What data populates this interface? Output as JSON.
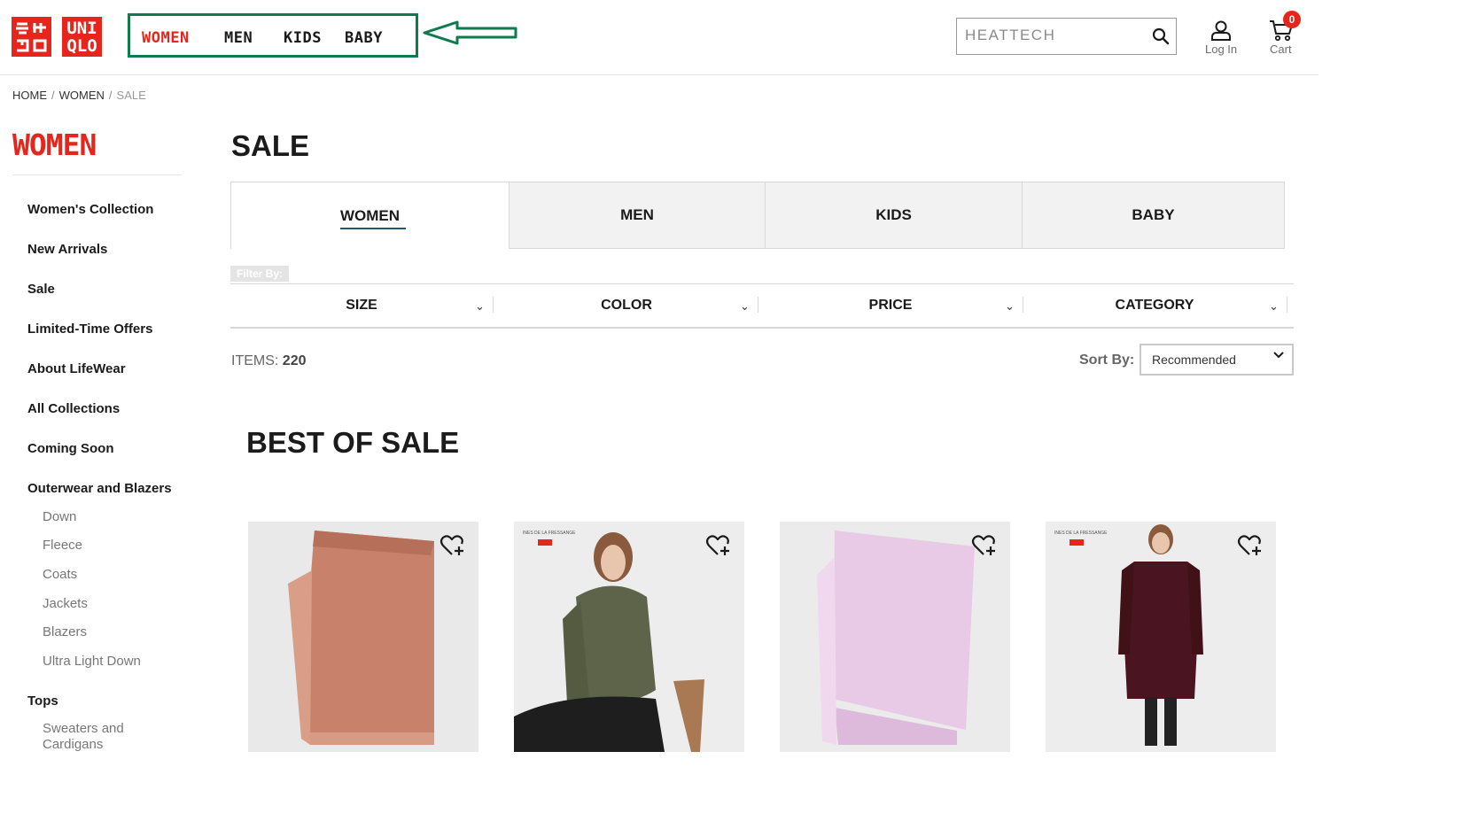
{
  "header": {
    "logo": {
      "top": "UNI",
      "bottom": "QLO"
    },
    "nav": [
      "WOMEN",
      "MEN",
      "KIDS",
      "BABY"
    ],
    "active_nav": "WOMEN",
    "search": {
      "placeholder": "HEATTECH",
      "value": ""
    },
    "login_label": "Log In",
    "cart_label": "Cart",
    "cart_count": "0",
    "colors": {
      "brand": "#e6261d",
      "highlight_box": "#0f7a4e"
    }
  },
  "breadcrumb": {
    "home": "HOME",
    "women": "WOMEN",
    "current": "SALE"
  },
  "sidebar": {
    "title": "WOMEN",
    "items": [
      "Women's Collection",
      "New Arrivals",
      "Sale",
      "Limited-Time Offers",
      "About LifeWear",
      "All Collections",
      "Coming Soon",
      "Outerwear and Blazers"
    ],
    "outerwear_sub": [
      "Down",
      "Fleece",
      "Coats",
      "Jackets",
      "Blazers",
      "Ultra Light Down"
    ],
    "tops": "Tops",
    "tops_sub": [
      "Sweaters and Cardigans"
    ]
  },
  "main": {
    "title": "SALE",
    "tabs": [
      "WOMEN",
      "MEN",
      "KIDS",
      "BABY"
    ],
    "filter_label": "Filter By:",
    "filters": [
      "SIZE",
      "COLOR",
      "PRICE",
      "CATEGORY"
    ],
    "items_label": "ITEMS:",
    "items_count": "220",
    "sort_label": "Sort By:",
    "sort_value": "Recommended",
    "section_title": "BEST OF SALE",
    "products": [
      {
        "image": "orange-scarf"
      },
      {
        "image": "woman-olive-shirt"
      },
      {
        "image": "pink-scarf"
      },
      {
        "image": "woman-burgundy-coat"
      }
    ],
    "product_tag": "INES DE LA FRESSANGE"
  }
}
